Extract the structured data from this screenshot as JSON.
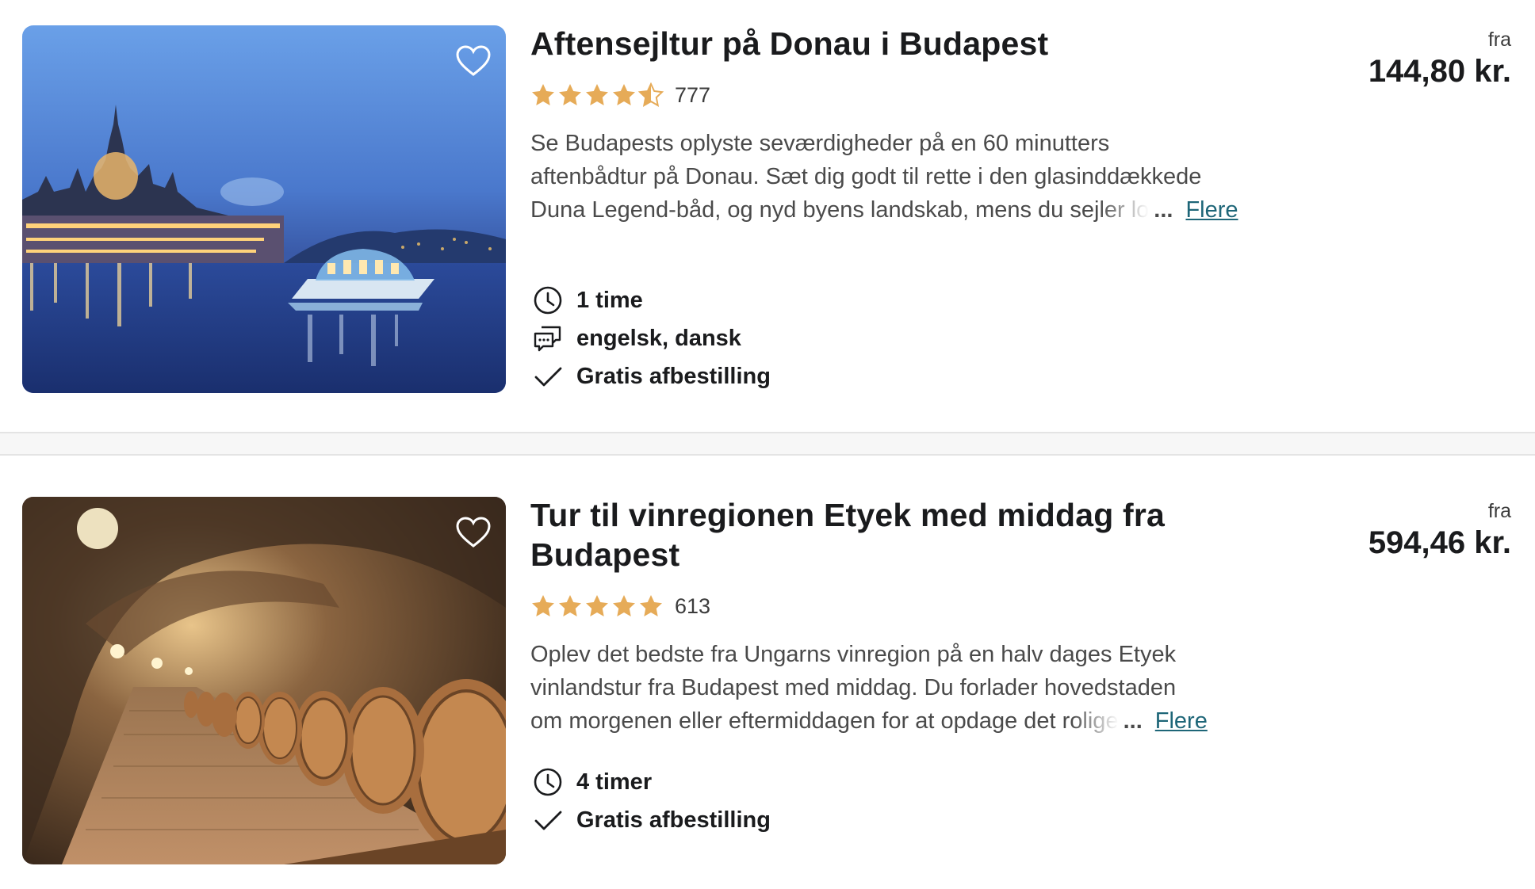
{
  "colors": {
    "star": "#e6ab58",
    "link": "#1e6678",
    "text": "#1a1b1d"
  },
  "results": [
    {
      "title": "Aftensejltur på Donau i Budapest",
      "rating": 4.5,
      "reviews": "777",
      "description_lines": [
        "Se Budapests oplyste seværdigheder på en 60 minutters",
        "aftenbådtur på Donau. Sæt dig godt til rette i den glasinddækkede",
        "Duna Legend-båd, og nyd byens landskab, mens du sejler lo"
      ],
      "ellipsis": "...",
      "more_label": "Flere",
      "features": [
        {
          "icon": "clock-icon",
          "label": "1 time"
        },
        {
          "icon": "chat-bubbles-icon",
          "label": "engelsk, dansk"
        },
        {
          "icon": "checkmark-icon",
          "label": "Gratis afbestilling"
        }
      ],
      "price_prefix": "fra",
      "price": "144,80 kr.",
      "image": "budapest-parliament-night-boat",
      "favorite_icon": "heart-icon"
    },
    {
      "title": "Tur til vinregionen Etyek med middag fra Budapest",
      "rating": 5,
      "reviews": "613",
      "description_lines": [
        "Oplev det bedste fra Ungarns vinregion på en halv dages Etyek",
        "vinlandstur fra Budapest med middag. Du forlader hovedstaden",
        "om morgenen eller eftermiddagen for at opdage det rolige"
      ],
      "ellipsis": "...",
      "more_label": "Flere",
      "features": [
        {
          "icon": "clock-icon",
          "label": "4 timer"
        },
        {
          "icon": "checkmark-icon",
          "label": "Gratis afbestilling"
        }
      ],
      "price_prefix": "fra",
      "price": "594,46 kr.",
      "image": "wine-cellar-barrels",
      "favorite_icon": "heart-icon"
    }
  ]
}
